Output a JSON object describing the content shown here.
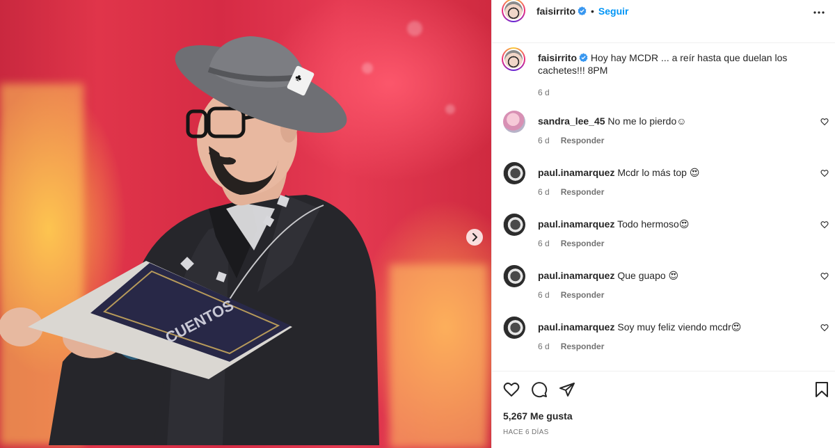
{
  "post": {
    "author": "faisirrito",
    "follow_label": "Seguir",
    "separator": "•",
    "caption_username": "faisirrito",
    "caption_text": "Hoy hay MCDR ... a reír hasta que duelan los cachetes!!! 8PM",
    "caption_time": "6 d",
    "likes": "5,267 Me gusta",
    "date": "HACE 6 DÍAS"
  },
  "comments": [
    {
      "username": "sandra_lee_45",
      "text": "No me lo pierdo☺",
      "time": "6 d",
      "reply_label": "Responder"
    },
    {
      "username": "paul.inamarquez",
      "text": "Mcdr lo más top 😍",
      "time": "6 d",
      "reply_label": "Responder"
    },
    {
      "username": "paul.inamarquez",
      "text": "Todo hermoso😍",
      "time": "6 d",
      "reply_label": "Responder"
    },
    {
      "username": "paul.inamarquez",
      "text": "Que guapo 😍",
      "time": "6 d",
      "reply_label": "Responder"
    },
    {
      "username": "paul.inamarquez",
      "text": "Soy muy feliz viendo mcdr😍",
      "time": "6 d",
      "reply_label": "Responder"
    }
  ],
  "media": {
    "book_text": "CUENTOS"
  },
  "icons": {
    "more": "more-options-icon",
    "verified": "verified-badge-icon",
    "next": "chevron-right-icon",
    "like": "heart-icon",
    "comment": "comment-icon",
    "share": "share-icon",
    "save": "bookmark-icon"
  },
  "colors": {
    "accent": "#0095f6",
    "text": "#262626",
    "secondary": "#737373",
    "border": "#efefef"
  }
}
